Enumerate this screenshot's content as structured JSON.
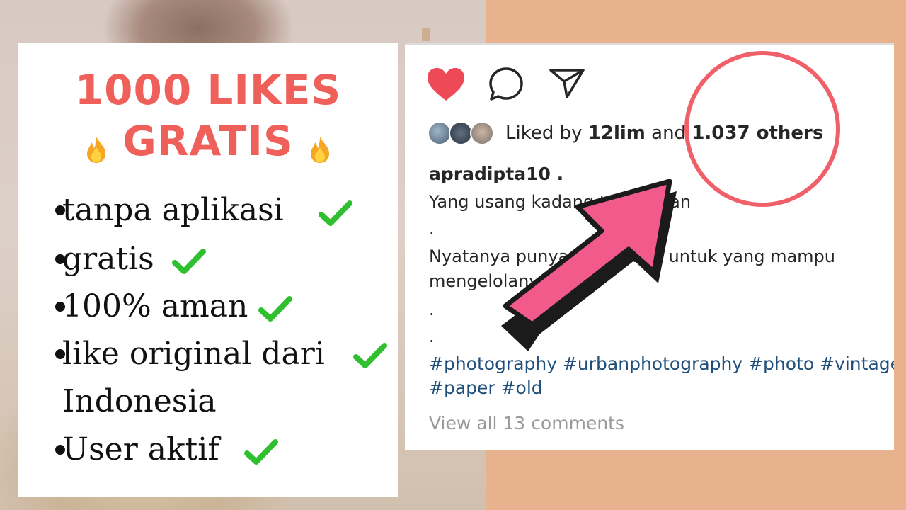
{
  "headline": {
    "line1": "1000 LIKES",
    "line2": "GRATIS"
  },
  "features": [
    "tanpa aplikasi",
    "gratis",
    "100% aman",
    "like original dari",
    "Indonesia",
    "User aktif"
  ],
  "post": {
    "likes_prefix": "Liked by ",
    "likes_user": "12lim",
    "likes_mid": " and ",
    "likes_count": "1.037 others",
    "username": "apradipta10 .",
    "caption": [
      "Yang usang kadang terlupakan",
      ".",
      "Nyatanya punya nilai tinggi untuk yang mampu",
      "mengelolanya",
      ".",
      "."
    ],
    "hashtags_line1": "#photography #urbanphotography #photo #vintage",
    "hashtags_line2": "#paper #old",
    "view_comments": "View all 13 comments"
  },
  "icons": {
    "like": "heart-icon",
    "comment": "comment-icon",
    "share": "send-icon",
    "fire": "fire-icon",
    "check": "check-icon"
  },
  "colors": {
    "headline": "#f0605a",
    "heart": "#ed4956",
    "check": "#2fbf2f",
    "hashtag": "#1f4f7a",
    "arrow": "#f25a8c",
    "circle": "#f0606a"
  }
}
